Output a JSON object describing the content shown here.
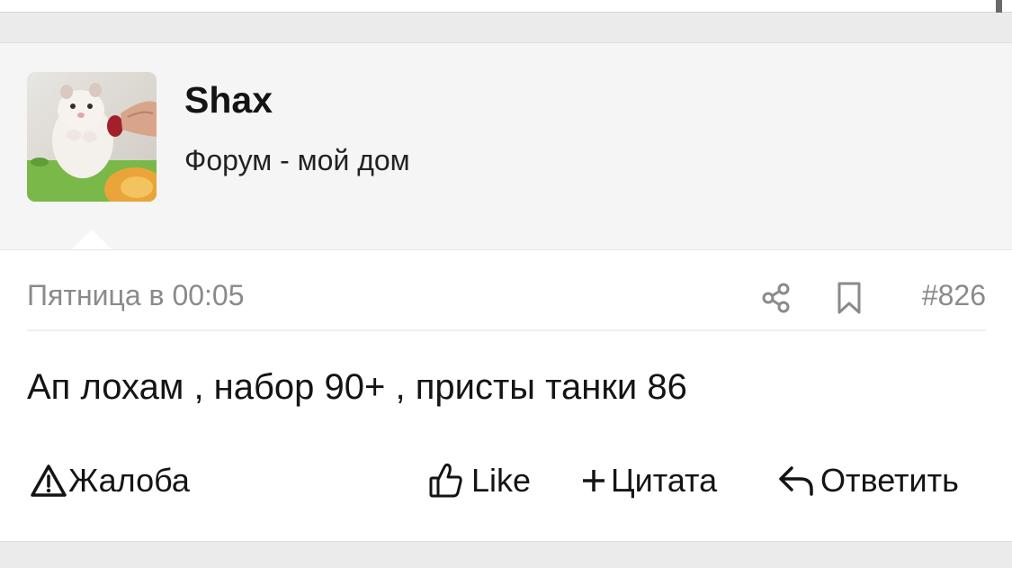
{
  "post": {
    "author": {
      "name": "Shax",
      "title": "Форум - мой дом",
      "avatar": "hamster-photo"
    },
    "date": "Пятница в 00:05",
    "number": "#826",
    "body": "Ап лохам , набор 90+ , присты танки 86",
    "actions": {
      "report": "Жалоба",
      "like": "Like",
      "quote": "Цитата",
      "reply": "Ответить"
    }
  },
  "icons": {
    "share": "share-icon",
    "bookmark": "bookmark-icon",
    "report": "warning-triangle-icon",
    "like": "thumbs-up-icon",
    "quote": "plus-icon",
    "reply": "reply-arrow-icon"
  },
  "colors": {
    "page_background": "#ebebeb",
    "header_background": "#f5f5f5",
    "meta_text": "#8a8a8a",
    "body_text": "#141414"
  }
}
